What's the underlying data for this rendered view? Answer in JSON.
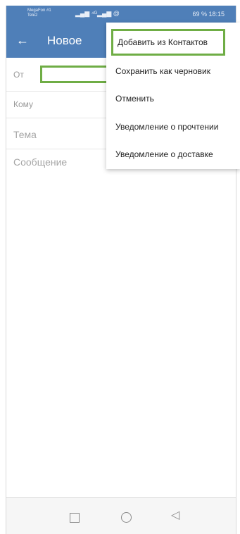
{
  "status_bar": {
    "carrier1": "MegaFon #1",
    "carrier2": "Tele2",
    "signal": "▂▄▆ ⁴ᴳ▂▄▆ @",
    "right": "69 % 18:15"
  },
  "header": {
    "back_icon": "←",
    "title": "Новое"
  },
  "form": {
    "from_label": "От",
    "from_value": "",
    "to_label": "Кому",
    "subject_label": "Тема",
    "message_label": "Сообщение"
  },
  "menu": {
    "items": [
      {
        "label": "Добавить из Контактов"
      },
      {
        "label": "Сохранить как черновик"
      },
      {
        "label": "Отменить"
      },
      {
        "label": "Уведомление о прочтении"
      },
      {
        "label": "Уведомление о доставке"
      }
    ]
  },
  "nav": {
    "recent_icon": "◁"
  },
  "colors": {
    "header": "#4f7fb8",
    "highlight": "#6fad45"
  }
}
